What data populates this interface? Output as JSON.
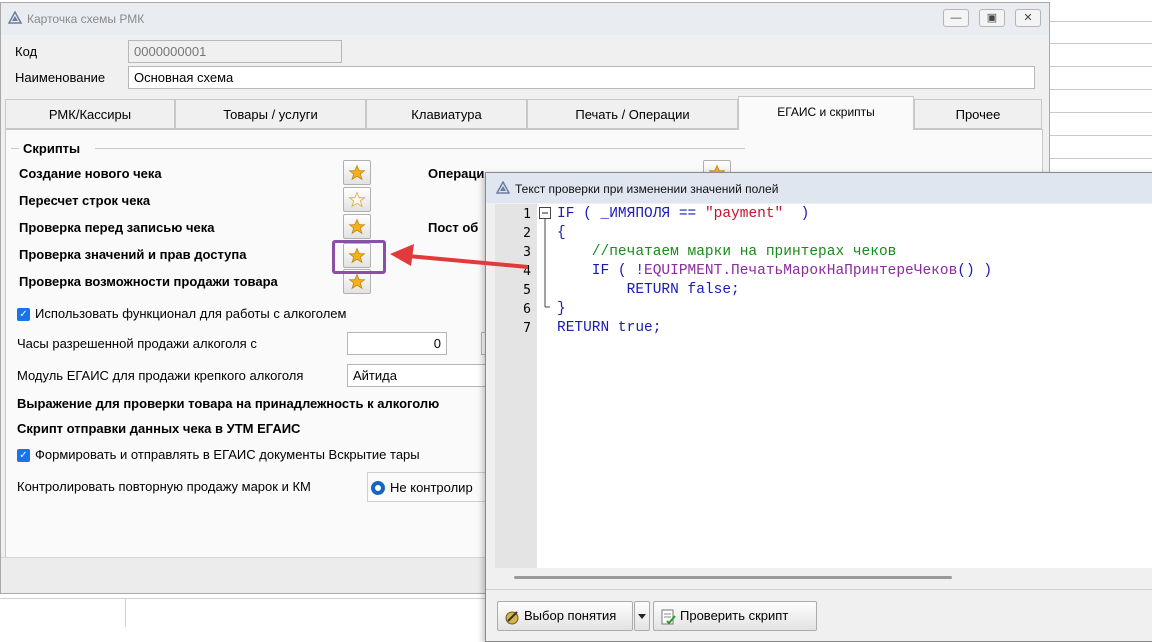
{
  "main_window": {
    "title": "Карточка схемы РМК",
    "code_label": "Код",
    "code_value": "0000000001",
    "name_label": "Наименование",
    "name_value": "Основная схема"
  },
  "tabs": [
    {
      "label": "РМК/Кассиры"
    },
    {
      "label": "Товары / услуги"
    },
    {
      "label": "Клавиатура"
    },
    {
      "label": "Печать / Операции"
    },
    {
      "label": "ЕГАИС и скрипты"
    },
    {
      "label": "Прочее"
    }
  ],
  "scripts": {
    "section_title": "Скрипты",
    "items": [
      {
        "label": "Создание нового чека",
        "filled": true
      },
      {
        "label": "Пересчет строк чека",
        "filled": false
      },
      {
        "label": "Проверка перед записью чека",
        "filled": true
      },
      {
        "label": "Проверка значений и прав доступа",
        "filled": true
      },
      {
        "label": "Проверка возможности продажи товара",
        "filled": true
      }
    ],
    "right_items": [
      {
        "label": "Операци"
      },
      {
        "label": "Пост об"
      }
    ]
  },
  "alcohol": {
    "use_checkbox_label": "Использовать функционал для работы с алкоголем",
    "use_checked": true,
    "hours_label": "Часы разрешенной продажи алкоголя с",
    "hours_from": "0",
    "module_label": "Модуль ЕГАИС для продажи крепкого алкоголя",
    "module_value": "Айтида",
    "expr_label": "Выражение для проверки товара на принадлежность к алкоголю",
    "utm_label": "Скрипт отправки данных чека в УТМ ЕГАИС",
    "form_checkbox_label": "Формировать и отправлять в ЕГАИС документы Вскрытие тары",
    "form_checked": true,
    "control_label": "Контролировать повторную продажу марок и КМ",
    "control_option": "Не контролир"
  },
  "script_window": {
    "title": "Текст проверки при изменении значений полей",
    "line_numbers": [
      "1",
      "2",
      "3",
      "4",
      "5",
      "6",
      "7"
    ],
    "code": {
      "l1_kw": "IF",
      "l1_open": " ( _ИМЯПОЛЯ == ",
      "l1_str": "\"payment\"",
      "l1_close": "  )",
      "l2": "{",
      "l3": "    //печатаем марки на принтерах чеков",
      "l4_a": "    IF ( !",
      "l4_b": "EQUIPMENT.ПечатьМарокНаПринтереЧеков",
      "l4_c": "() )",
      "l5": "        RETURN false;",
      "l6": "}",
      "l7": "RETURN true;"
    },
    "buttons": {
      "choose": "Выбор понятия",
      "check": "Проверить скрипт"
    }
  },
  "colors": {
    "keyword": "#1a1ab8",
    "string": "#c8102e",
    "comment": "#1a8a1a",
    "function": "#8c2aa0",
    "highlight": "#8d4fa6",
    "arrow": "#e03a3a"
  }
}
